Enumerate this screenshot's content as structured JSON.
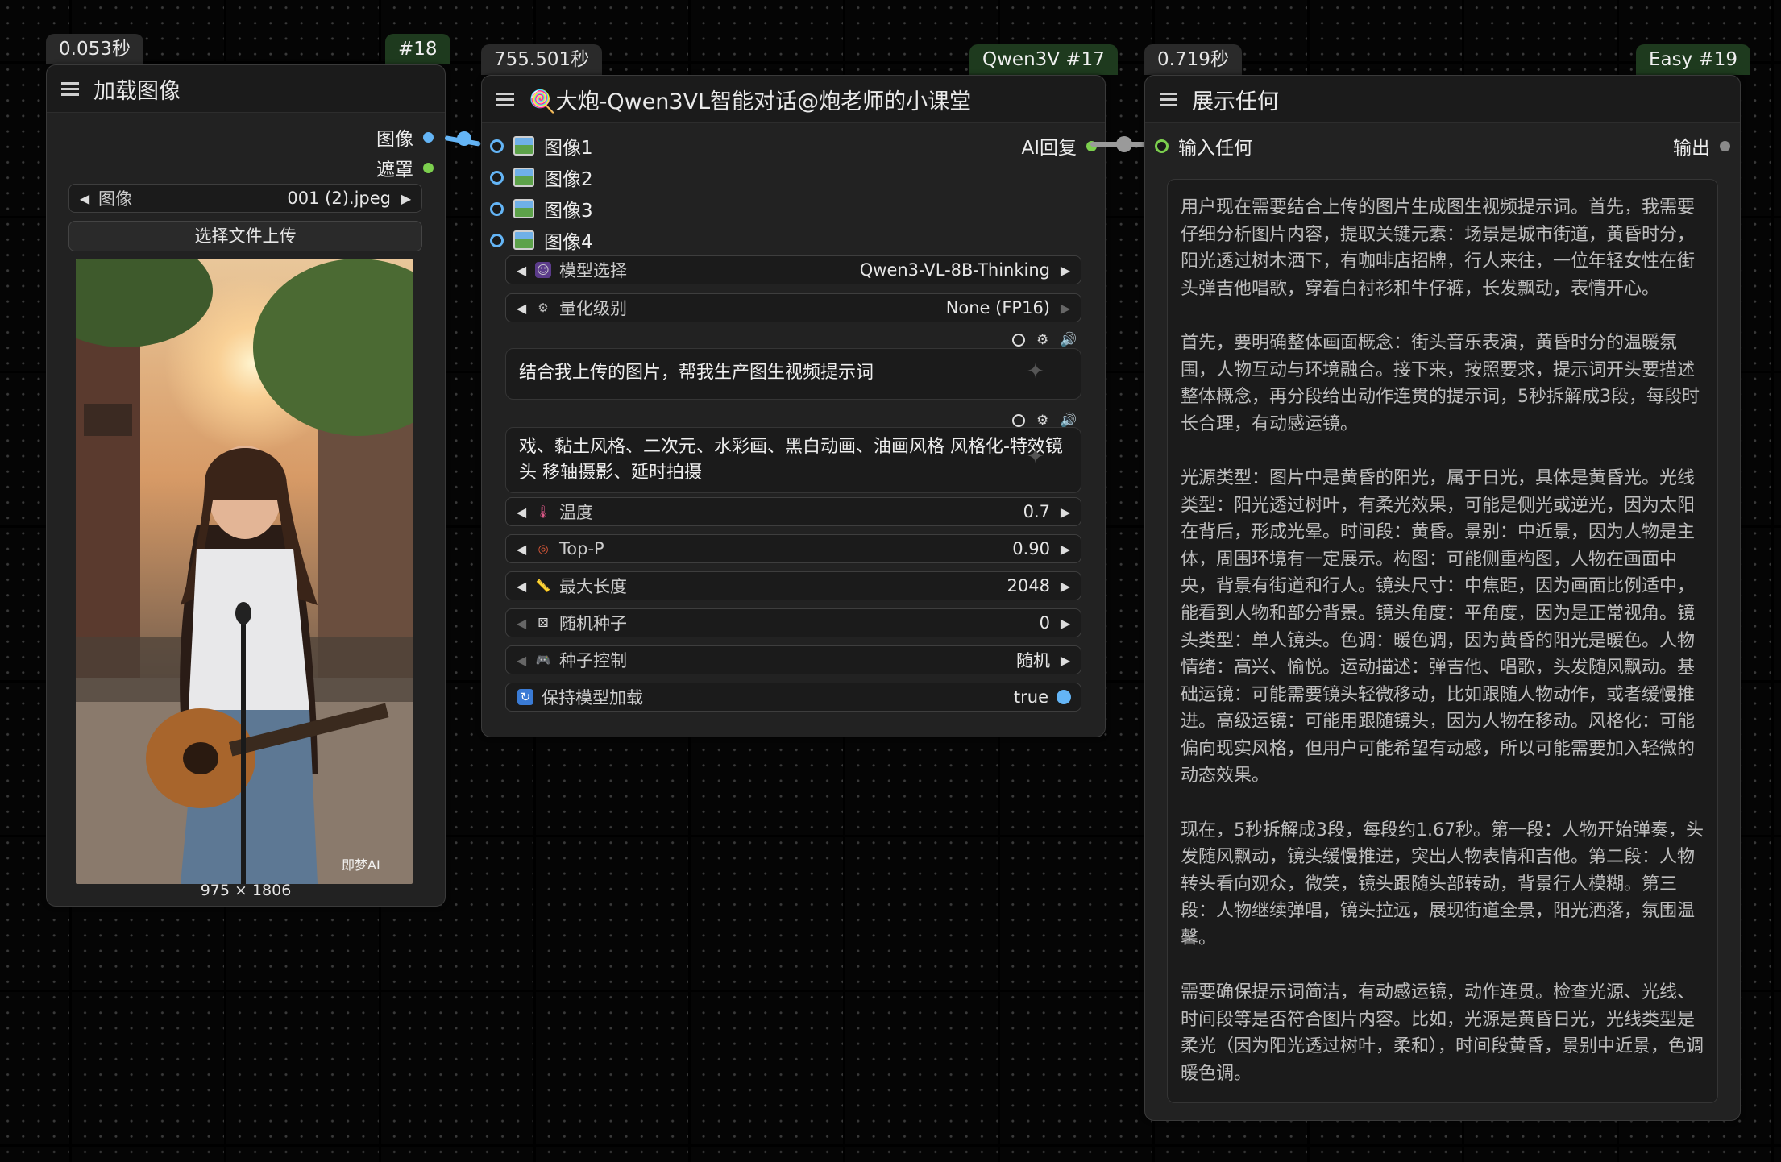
{
  "node18": {
    "time": "0.053秒",
    "id": "#18",
    "title": "加载图像",
    "out_image": "图像",
    "out_mask": "遮罩",
    "image_label": "图像",
    "image_value": "001 (2).jpeg",
    "upload_label": "选择文件上传",
    "dimensions": "975 × 1806",
    "preview_watermark": "即梦AI"
  },
  "node17": {
    "time": "755.501秒",
    "id": "Qwen3V #17",
    "title": "🍭大炮-Qwen3VL智能对话@炮老师的小课堂",
    "inputs": [
      "图像1",
      "图像2",
      "图像3",
      "图像4"
    ],
    "output": "AI回复",
    "model_label": "模型选择",
    "model_value": "Qwen3-VL-8B-Thinking",
    "quant_label": "量化级别",
    "quant_value": "None (FP16)",
    "prompt1": "结合我上传的图片，帮我生产图生视频提示词",
    "prompt2": "戏、黏土风格、二次元、水彩画、黑白动画、油画风格 风格化-特效镜头 移轴摄影、延时拍摄",
    "temp_label": "温度",
    "temp_value": "0.7",
    "topp_label": "Top-P",
    "topp_value": "0.90",
    "maxlen_label": "最大长度",
    "maxlen_value": "2048",
    "seed_label": "随机种子",
    "seed_value": "0",
    "seedctl_label": "种子控制",
    "seedctl_value": "随机",
    "keep_label": "保持模型加载",
    "keep_value": "true"
  },
  "node19": {
    "time": "0.719秒",
    "id": "Easy #19",
    "title": "展示任何",
    "input": "输入任何",
    "output": "输出",
    "text": "用户现在需要结合上传的图片生成图生视频提示词。首先，我需要仔细分析图片内容，提取关键元素：场景是城市街道，黄昏时分，阳光透过树木洒下，有咖啡店招牌，行人来往，一位年轻女性在街头弹吉他唱歌，穿着白衬衫和牛仔裤，长发飘动，表情开心。\n\n首先，要明确整体画面概念：街头音乐表演，黄昏时分的温暖氛围，人物互动与环境融合。接下来，按照要求，提示词开头要描述整体概念，再分段给出动作连贯的提示词，5秒拆解成3段，每段时长合理，有动感运镜。\n\n光源类型：图片中是黄昏的阳光，属于日光，具体是黄昏光。光线类型：阳光透过树叶，有柔光效果，可能是侧光或逆光，因为太阳在背后，形成光晕。时间段：黄昏。景别：中近景，因为人物是主体，周围环境有一定展示。构图：可能侧重构图，人物在画面中央，背景有街道和行人。镜头尺寸：中焦距，因为画面比例适中，能看到人物和部分背景。镜头角度：平角度，因为是正常视角。镜头类型：单人镜头。色调：暖色调，因为黄昏的阳光是暖色。人物情绪：高兴、愉悦。运动描述：弹吉他、唱歌，头发随风飘动。基础运镜：可能需要镜头轻微移动，比如跟随人物动作，或者缓慢推进。高级运镜：可能用跟随镜头，因为人物在移动。风格化：可能偏向现实风格，但用户可能希望有动感，所以可能需要加入轻微的动态效果。\n\n现在，5秒拆解成3段，每段约1.67秒。第一段：人物开始弹奏，头发随风飘动，镜头缓慢推进，突出人物表情和吉他。第二段：人物转头看向观众，微笑，镜头跟随头部转动，背景行人模糊。第三段：人物继续弹唱，镜头拉远，展现街道全景，阳光洒落，氛围温馨。\n\n需要确保提示词简洁，有动感运镜，动作连贯。检查光源、光线、时间段等是否符合图片内容。比如，光源是黄昏日光，光线类型是柔光（因为阳光透过树叶，柔和），时间段黄昏，景别中近景，色调暖色调。"
  }
}
